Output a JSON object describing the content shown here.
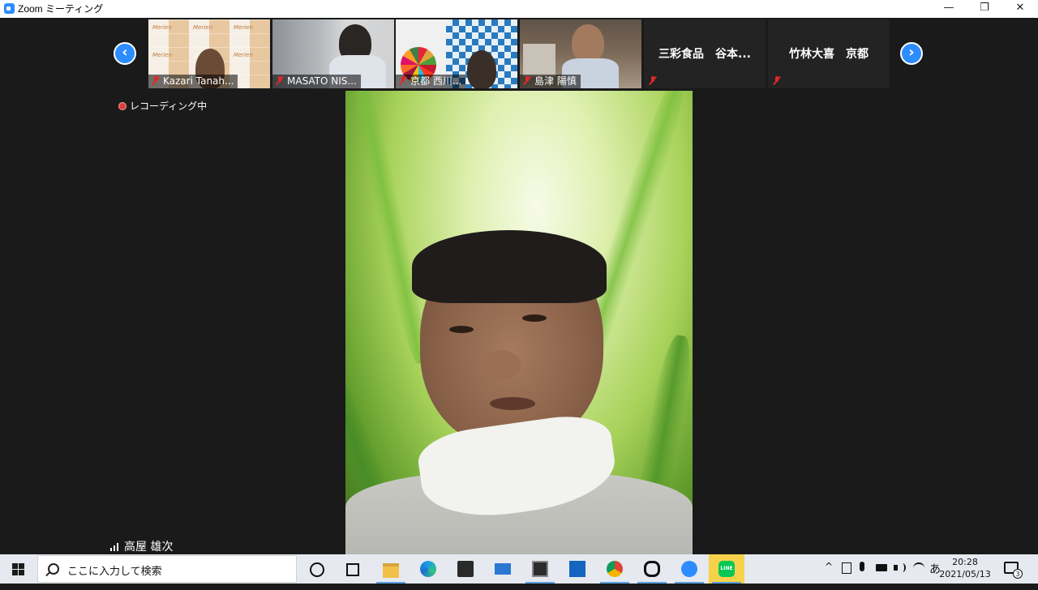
{
  "window": {
    "title": "Zoom ミーティング",
    "minimize_icon": "minimize-icon",
    "maximize_icon": "restore-icon",
    "close_icon": "close-icon",
    "min_glyph": "—",
    "max_glyph": "❐",
    "close_glyph": "✕"
  },
  "gallery": {
    "prev_glyph": "‹",
    "next_glyph": "›",
    "tiles": [
      {
        "name": "Kazari Tanah...",
        "muted": true
      },
      {
        "name": "MASATO NIS...",
        "muted": true
      },
      {
        "name": "京都 西川...",
        "muted": true
      },
      {
        "name": "島津 陽慎",
        "muted": true
      },
      {
        "name": "三彩食品　谷本...",
        "muted": true,
        "video": false
      },
      {
        "name": "竹林大喜　京都",
        "muted": true,
        "video": false
      }
    ],
    "merien_logo": "Merien"
  },
  "recording": {
    "label": "レコーディング中"
  },
  "active_speaker": {
    "name": "高屋 雄次"
  },
  "taskbar": {
    "search_placeholder": "ここに入力して検索",
    "clock_time": "20:28",
    "clock_date": "2021/05/13",
    "ime": "あ",
    "notification_count": "3",
    "tray_chevron": "^",
    "apps": [
      "task-view",
      "file-explorer",
      "edge",
      "store",
      "mail",
      "app-generic",
      "app-blue",
      "chrome",
      "app-outline",
      "zoom",
      "line"
    ],
    "line_label": "LINE"
  },
  "colors": {
    "zoom_blue": "#2d8cff",
    "muted_red": "#e02828",
    "rec_red": "#e03c3c",
    "background": "#1a1a1a",
    "line_highlight": "#f6d24a"
  }
}
